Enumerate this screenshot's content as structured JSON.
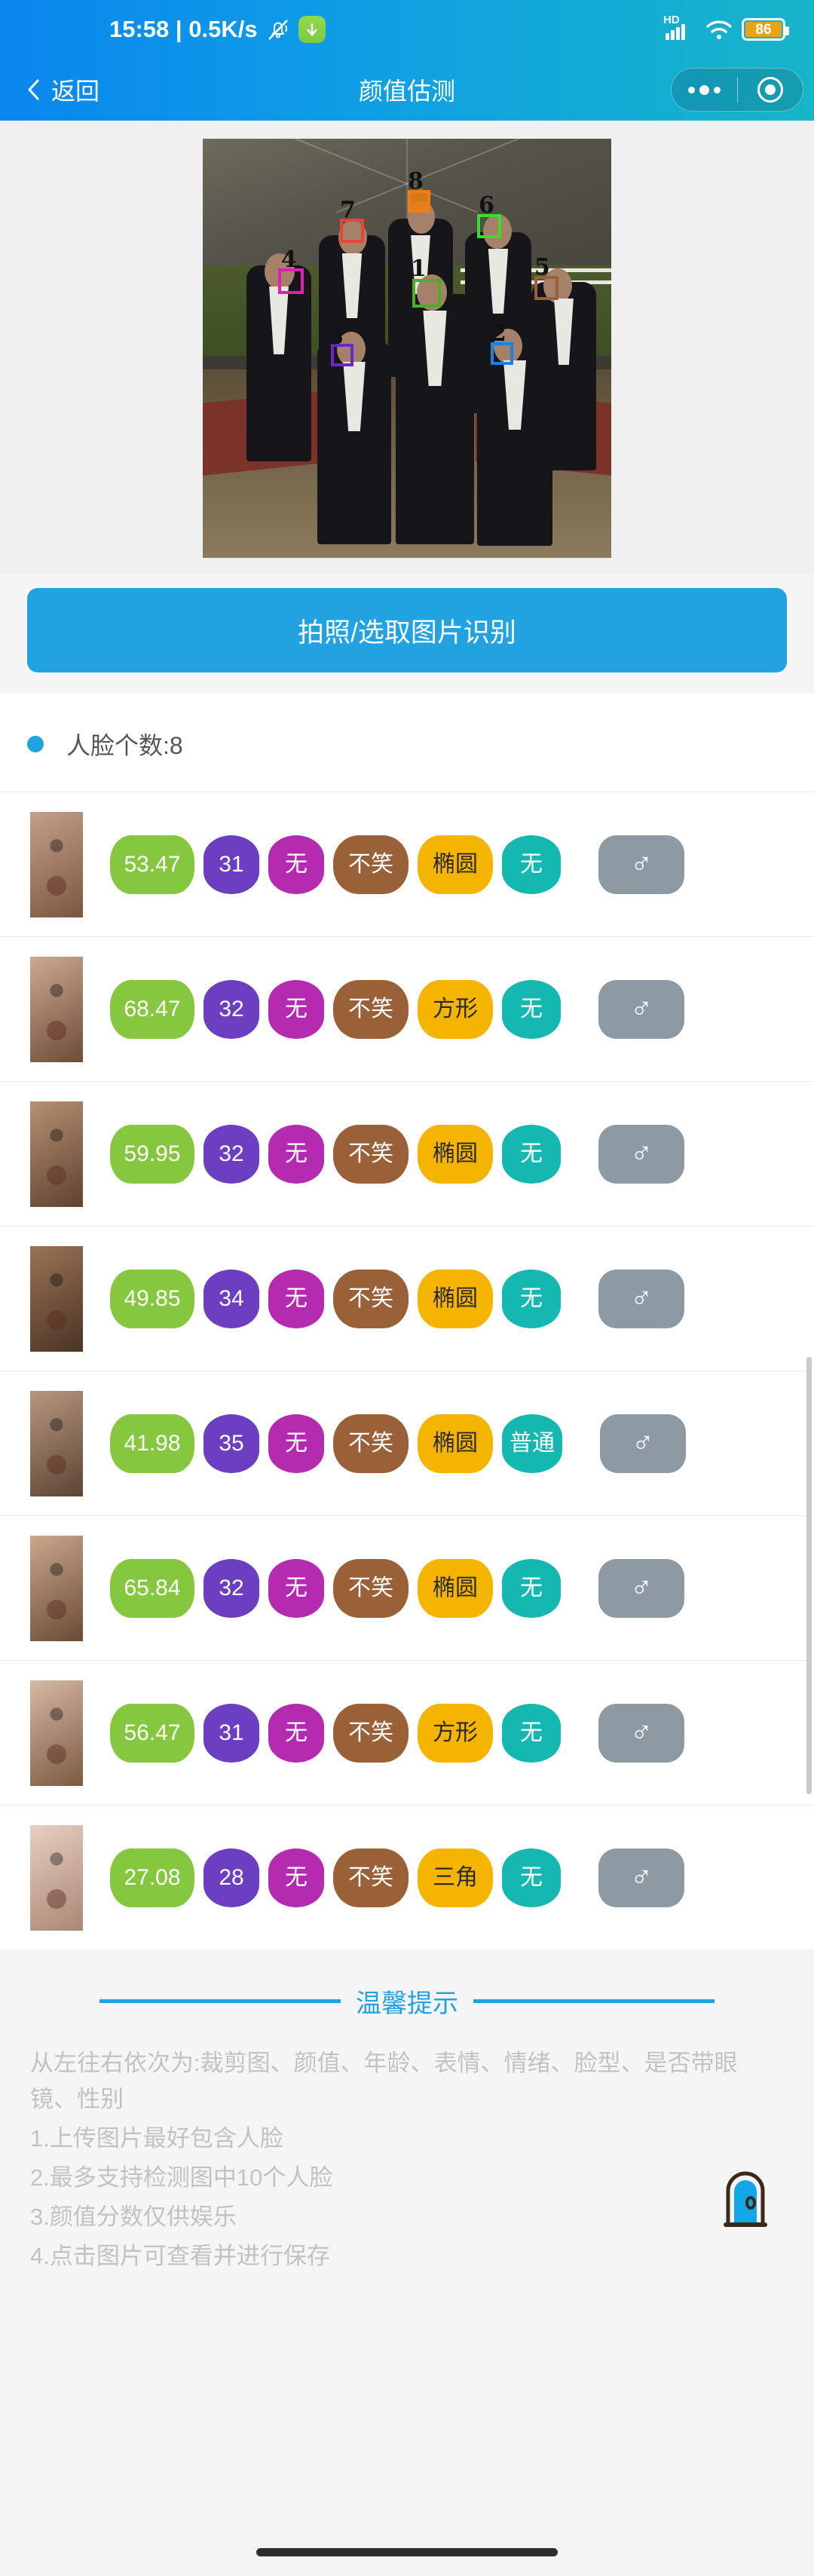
{
  "status_bar": {
    "time": "15:58",
    "separator": "|",
    "network_speed": "0.5K/s",
    "bell_icon": "bell-muted-icon",
    "download_icon": "download-badge-icon",
    "hd_label": "HD",
    "signal_icon": "signal-bars-icon",
    "wifi_icon": "wifi-icon",
    "battery_percent": "86"
  },
  "nav": {
    "back_label": "返回",
    "back_icon": "chevron-left-icon",
    "title": "颜值估测",
    "more_icon": "more-dots-icon",
    "target_icon": "target-circle-icon"
  },
  "photo": {
    "alt": "groomsmen-group-photo-with-face-boxes",
    "face_boxes": [
      {
        "num": "1",
        "color": "#4caf22"
      },
      {
        "num": "2",
        "color": "#1a82e2"
      },
      {
        "num": "3",
        "color": "#6a28c8"
      },
      {
        "num": "4",
        "color": "#e020b0"
      },
      {
        "num": "5",
        "color": "#9a6138"
      },
      {
        "num": "6",
        "color": "#3ddb2a"
      },
      {
        "num": "7",
        "color": "#e8443a"
      },
      {
        "num": "8",
        "color": "#ef7e12"
      }
    ]
  },
  "action_button": {
    "label": "拍照/选取图片识别",
    "color": "#22a2e0"
  },
  "face_count": {
    "label": "人脸个数:8",
    "dot_color": "#22a2e0"
  },
  "faces": [
    {
      "score": "53.47",
      "age": "31",
      "expression": "无",
      "smile": "不笑",
      "shape": "椭圆",
      "glasses": "无",
      "gender": "♂"
    },
    {
      "score": "68.47",
      "age": "32",
      "expression": "无",
      "smile": "不笑",
      "shape": "方形",
      "glasses": "无",
      "gender": "♂"
    },
    {
      "score": "59.95",
      "age": "32",
      "expression": "无",
      "smile": "不笑",
      "shape": "椭圆",
      "glasses": "无",
      "gender": "♂"
    },
    {
      "score": "49.85",
      "age": "34",
      "expression": "无",
      "smile": "不笑",
      "shape": "椭圆",
      "glasses": "无",
      "gender": "♂"
    },
    {
      "score": "41.98",
      "age": "35",
      "expression": "无",
      "smile": "不笑",
      "shape": "椭圆",
      "glasses": "普通",
      "gender": "♂"
    },
    {
      "score": "65.84",
      "age": "32",
      "expression": "无",
      "smile": "不笑",
      "shape": "椭圆",
      "glasses": "无",
      "gender": "♂"
    },
    {
      "score": "56.47",
      "age": "31",
      "expression": "无",
      "smile": "不笑",
      "shape": "方形",
      "glasses": "无",
      "gender": "♂"
    },
    {
      "score": "27.08",
      "age": "28",
      "expression": "无",
      "smile": "不笑",
      "shape": "三角",
      "glasses": "无",
      "gender": "♂"
    }
  ],
  "tips": {
    "title": "温馨提示",
    "lines": [
      "从左往右依次为:裁剪图、颜值、年龄、表情、情绪、脸型、是否带眼镜、性别",
      "1.上传图片最好包含人脸",
      "2.最多支持检测图中10个人脸",
      "3.颜值分数仅供娱乐",
      "4.点击图片可查看并进行保存"
    ],
    "door_icon": "door-arch-icon"
  }
}
